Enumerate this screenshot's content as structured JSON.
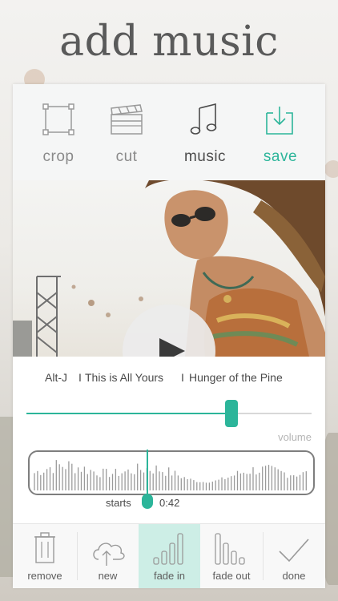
{
  "headline": "add music",
  "toolbar": {
    "crop": "crop",
    "cut": "cut",
    "music": "music",
    "save": "save"
  },
  "track": {
    "artist": "Alt-J",
    "separator1": "I",
    "album": "This is All Yours",
    "separator2": "I",
    "song": "Hunger of the Pine"
  },
  "volume": {
    "label": "volume",
    "level": 0.72
  },
  "waveform": {
    "start_position": 0.42,
    "starts_label": "starts",
    "time": "0:42"
  },
  "bottom": {
    "remove": "remove",
    "new": "new",
    "fade_in": "fade in",
    "fade_out": "fade out",
    "done": "done"
  },
  "colors": {
    "accent": "#2cb59a",
    "headline": "#5a5a5a",
    "selected_bg": "#cdeee6"
  }
}
